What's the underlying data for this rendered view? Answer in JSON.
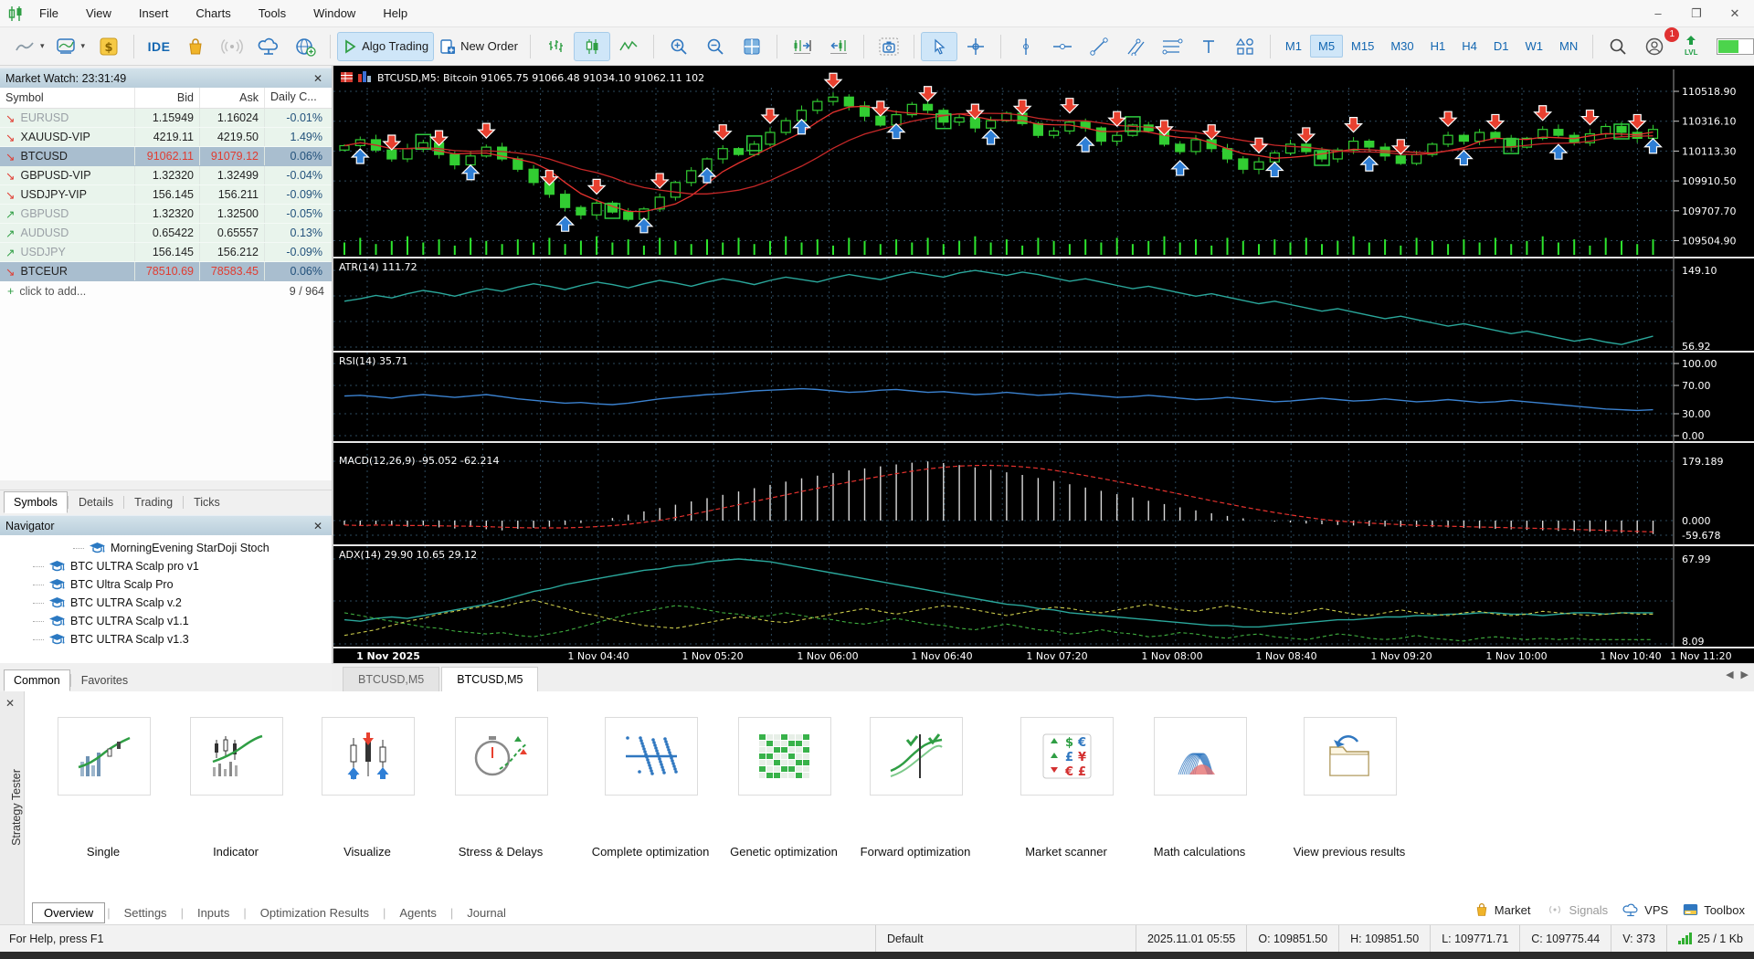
{
  "glyphs": {
    "close": "✕",
    "caret": "▾",
    "minimize": "–",
    "maximize": "❐",
    "window_close": "✕",
    "left": "◀",
    "right": "▶",
    "plus": "+",
    "down_arrow": "↘",
    "up_arrow": "↗"
  },
  "menu": {
    "items": [
      "File",
      "View",
      "Insert",
      "Charts",
      "Tools",
      "Window",
      "Help"
    ]
  },
  "toolbar": {
    "algo_trading": "Algo Trading",
    "new_order": "New Order",
    "ide_label": "IDE",
    "lvl_label": "LVL",
    "timeframes": [
      "M1",
      "M5",
      "M15",
      "M30",
      "H1",
      "H4",
      "D1",
      "W1",
      "MN"
    ],
    "active_timeframe": "M5",
    "notification_count": "1"
  },
  "market_watch": {
    "title": "Market Watch: 23:31:49",
    "columns": [
      "Symbol",
      "Bid",
      "Ask",
      "Daily C..."
    ],
    "rows": [
      {
        "symbol": "EURUSD",
        "bid": "1.15949",
        "ask": "1.16024",
        "daily": "-0.01%",
        "dir": "down",
        "dim": true,
        "selected": false,
        "hot": false
      },
      {
        "symbol": "XAUUSD-VIP",
        "bid": "4219.11",
        "ask": "4219.50",
        "daily": "1.49%",
        "dir": "down",
        "dim": false,
        "selected": false,
        "hot": false
      },
      {
        "symbol": "BTCUSD",
        "bid": "91062.11",
        "ask": "91079.12",
        "daily": "0.06%",
        "dir": "down",
        "dim": false,
        "selected": true,
        "hot": true
      },
      {
        "symbol": "GBPUSD-VIP",
        "bid": "1.32320",
        "ask": "1.32499",
        "daily": "-0.04%",
        "dir": "down",
        "dim": false,
        "selected": false,
        "hot": false
      },
      {
        "symbol": "USDJPY-VIP",
        "bid": "156.145",
        "ask": "156.211",
        "daily": "-0.09%",
        "dir": "down",
        "dim": false,
        "selected": false,
        "hot": false
      },
      {
        "symbol": "GBPUSD",
        "bid": "1.32320",
        "ask": "1.32500",
        "daily": "-0.05%",
        "dir": "up",
        "dim": true,
        "selected": false,
        "hot": false
      },
      {
        "symbol": "AUDUSD",
        "bid": "0.65422",
        "ask": "0.65557",
        "daily": "0.13%",
        "dir": "up",
        "dim": true,
        "selected": false,
        "hot": false
      },
      {
        "symbol": "USDJPY",
        "bid": "156.145",
        "ask": "156.212",
        "daily": "-0.09%",
        "dir": "up",
        "dim": true,
        "selected": false,
        "hot": false
      },
      {
        "symbol": "BTCEUR",
        "bid": "78510.69",
        "ask": "78583.45",
        "daily": "0.06%",
        "dir": "down",
        "dim": false,
        "selected": true,
        "hot": true
      }
    ],
    "add_row": "click to add...",
    "count": "9 / 964",
    "tabs": [
      "Symbols",
      "Details",
      "Trading",
      "Ticks"
    ],
    "active_tab": "Symbols"
  },
  "navigator": {
    "title": "Navigator",
    "items": [
      {
        "label": "MorningEvening StarDoji Stoch",
        "depth": 2
      },
      {
        "label": "BTC ULTRA Scalp pro v1",
        "depth": 1
      },
      {
        "label": "BTC Ultra Scalp Pro",
        "depth": 1
      },
      {
        "label": "BTC ULTRA Scalp v.2",
        "depth": 1
      },
      {
        "label": "BTC ULTRA Scalp v1.1",
        "depth": 1
      },
      {
        "label": "BTC ULTRA Scalp v1.3",
        "depth": 1
      }
    ],
    "tabs": [
      "Common",
      "Favorites"
    ],
    "active_tab": "Common"
  },
  "chart_tabs": {
    "tabs": [
      "BTCUSD,M5",
      "BTCUSD,M5"
    ],
    "active_index": 1
  },
  "tester": {
    "vertical_label": "Strategy Tester",
    "tiles": [
      {
        "label": "Single",
        "icon": "single-icon"
      },
      {
        "label": "Indicator",
        "icon": "indicator-icon"
      },
      {
        "label": "Visualize",
        "icon": "visualize-icon"
      },
      {
        "label": "Stress & Delays",
        "icon": "stress-delays-icon"
      },
      {
        "label": "Complete optimization",
        "icon": "complete-optimization-icon"
      },
      {
        "label": "Genetic optimization",
        "icon": "genetic-optimization-icon"
      },
      {
        "label": "Forward optimization",
        "icon": "forward-optimization-icon"
      },
      {
        "label": "Market scanner",
        "icon": "market-scanner-icon"
      },
      {
        "label": "Math calculations",
        "icon": "math-calculations-icon"
      },
      {
        "label": "View previous results",
        "icon": "view-previous-results-icon"
      }
    ],
    "tabs": [
      "Overview",
      "Settings",
      "Inputs",
      "Optimization Results",
      "Agents",
      "Journal"
    ],
    "active_tab": "Overview",
    "right_items": [
      {
        "label": "Market",
        "icon": "bag-icon",
        "dim": false
      },
      {
        "label": "Signals",
        "icon": "signal-icon",
        "dim": true
      },
      {
        "label": "VPS",
        "icon": "cloud-icon",
        "dim": false
      },
      {
        "label": "Toolbox",
        "icon": "toolbox-icon",
        "dim": false
      }
    ]
  },
  "status_bar": {
    "help": "For Help, press F1",
    "profile": "Default",
    "datetime": "2025.11.01 05:55",
    "o": "O: 109851.50",
    "h": "H: 109851.50",
    "l": "L: 109771.71",
    "c": "C: 109775.44",
    "v": "V: 373",
    "traffic": "25 / 1 Kb"
  },
  "chart_data": {
    "type": "candlestick+indicators",
    "title": "BTCUSD,M5: Bitcoin 91065.75 91066.48 91034.10 91062.11 102",
    "colors": {
      "bg": "#000000",
      "grid": "#2c4a5e",
      "bull": "#32cd32",
      "volume": "#2ee52e",
      "ma_fast": "#e5322e",
      "ma_slow": "#c62828",
      "atr": "#2aa79b",
      "rsi": "#3b82d0",
      "macd_hist": "#d8d8d8",
      "macd_signal": "#e5322e",
      "adx": "#2aa79b",
      "plus_di": "#3fae3f",
      "minus_di": "#c9c94a",
      "arrow_down": "#e8402f",
      "arrow_up": "#2f7fd6",
      "box": "#2ecc40",
      "text": "#ffffff"
    },
    "time_axis": {
      "labels": [
        "1 Nov 2025",
        "1 Nov 04:40",
        "1 Nov 05:20",
        "1 Nov 06:00",
        "1 Nov 06:40",
        "1 Nov 07:20",
        "1 Nov 08:00",
        "1 Nov 08:40",
        "1 Nov 09:20",
        "1 Nov 10:00",
        "1 Nov 10:40",
        "1 Nov 11:20"
      ],
      "centers": [
        60,
        290,
        415,
        541,
        666,
        792,
        918,
        1043,
        1169,
        1295,
        1420,
        1497
      ]
    },
    "main": {
      "yticks": [
        "110518.90",
        "110316.10",
        "110113.30",
        "109910.50",
        "109707.70",
        "109504.90"
      ],
      "ylim": [
        109409,
        110667
      ],
      "closes": [
        110150,
        110190,
        110120,
        110060,
        110130,
        110170,
        110090,
        110020,
        110080,
        110140,
        110060,
        109990,
        109900,
        109820,
        109730,
        109680,
        109760,
        109700,
        109650,
        109720,
        109800,
        109900,
        109980,
        110060,
        110130,
        110090,
        110160,
        110240,
        110320,
        110390,
        110450,
        110480,
        110420,
        110350,
        110290,
        110360,
        110430,
        110390,
        110310,
        110340,
        110270,
        110320,
        110370,
        110300,
        110220,
        110250,
        110310,
        110270,
        110180,
        110220,
        110290,
        110250,
        110160,
        110110,
        110190,
        110130,
        110060,
        109990,
        110040,
        110100,
        110160,
        110110,
        110060,
        110120,
        110180,
        110140,
        110080,
        110030,
        110090,
        110160,
        110220,
        110180,
        110240,
        110200,
        110140,
        110200,
        110260,
        110220,
        110170,
        110230,
        110280,
        110240,
        110200,
        110260
      ],
      "volume": [
        0.5,
        0.8,
        0.4,
        0.6,
        0.9,
        0.5,
        0.7,
        0.3,
        0.8,
        0.6,
        0.4,
        0.7,
        0.5,
        0.8,
        0.4,
        0.6,
        0.9,
        0.5,
        0.7,
        0.3,
        0.8,
        0.6,
        0.4,
        0.7,
        0.5,
        0.8,
        0.4,
        0.6,
        0.9,
        0.5,
        0.7,
        0.3,
        0.8,
        0.6,
        0.4,
        0.7,
        0.5,
        0.8,
        0.4,
        0.6,
        0.9,
        0.5,
        0.7,
        0.3,
        0.8,
        0.6,
        0.4,
        0.7,
        0.5,
        0.8,
        0.4,
        0.6,
        0.9,
        0.5,
        0.7,
        0.3,
        0.8,
        0.6,
        0.4,
        0.7,
        0.5,
        0.8,
        0.4,
        0.6,
        0.9,
        0.5,
        0.7,
        0.3,
        0.8,
        0.6,
        0.4,
        0.7,
        0.5,
        0.8,
        0.4,
        0.6,
        0.9,
        0.5,
        0.7,
        0.3,
        0.8,
        0.6,
        0.4,
        0.7
      ],
      "red_arrows": [
        3,
        6,
        9,
        13,
        16,
        20,
        24,
        27,
        31,
        34,
        37,
        40,
        43,
        46,
        49,
        52,
        55,
        58,
        61,
        64,
        67,
        70,
        73,
        76,
        79,
        82
      ],
      "blue_arrows": [
        1,
        8,
        14,
        19,
        23,
        29,
        35,
        41,
        47,
        53,
        59,
        65,
        71,
        77,
        83
      ],
      "green_boxes": [
        5,
        17,
        26,
        38,
        50,
        62,
        74,
        81
      ]
    },
    "atr": {
      "label": "ATR(14) 111.72",
      "yticks": [
        "149.10",
        "56.92"
      ],
      "values": [
        112,
        115,
        119,
        116,
        121,
        125,
        122,
        118,
        123,
        127,
        124,
        129,
        133,
        130,
        126,
        131,
        135,
        132,
        128,
        133,
        137,
        134,
        130,
        135,
        139,
        136,
        132,
        137,
        141,
        138,
        135,
        140,
        144,
        141,
        138,
        143,
        147,
        144,
        141,
        146,
        149,
        146,
        143,
        147,
        144,
        140,
        136,
        139,
        135,
        131,
        127,
        130,
        126,
        122,
        118,
        121,
        117,
        113,
        109,
        112,
        108,
        104,
        100,
        103,
        99,
        95,
        91,
        94,
        90,
        86,
        82,
        85,
        81,
        77,
        73,
        76,
        72,
        68,
        64,
        67,
        63,
        60,
        65,
        70
      ]
    },
    "rsi": {
      "label": "RSI(14) 35.71",
      "yticks": [
        "100.00",
        "70.00",
        "30.00",
        "0.00"
      ],
      "values": [
        55,
        56,
        54,
        52,
        55,
        57,
        55,
        53,
        55,
        57,
        54,
        51,
        49,
        47,
        45,
        46,
        44,
        43,
        45,
        48,
        51,
        53,
        55,
        57,
        58,
        60,
        62,
        63,
        64,
        65,
        64,
        62,
        60,
        61,
        63,
        64,
        62,
        60,
        61,
        59,
        57,
        58,
        60,
        58,
        56,
        57,
        59,
        57,
        55,
        53,
        54,
        56,
        54,
        52,
        50,
        51,
        53,
        51,
        49,
        47,
        48,
        50,
        52,
        50,
        48,
        49,
        51,
        49,
        47,
        48,
        50,
        48,
        46,
        47,
        49,
        47,
        45,
        43,
        41,
        39,
        37,
        36,
        35,
        36
      ]
    },
    "macd": {
      "label": "MACD(12,26,9) -95.052 -62.214",
      "yticks": [
        "179.189",
        "0.000",
        "-59.678"
      ],
      "hist": [
        -18,
        -22,
        -15,
        -20,
        -25,
        -20,
        -28,
        -32,
        -26,
        -35,
        -40,
        -34,
        -30,
        -25,
        -18,
        -10,
        -2,
        8,
        18,
        28,
        38,
        48,
        58,
        68,
        78,
        88,
        98,
        108,
        118,
        128,
        136,
        144,
        152,
        158,
        164,
        170,
        175,
        179,
        174,
        168,
        161,
        154,
        146,
        138,
        129,
        120,
        110,
        100,
        90,
        80,
        70,
        60,
        50,
        40,
        31,
        22,
        14,
        7,
        1,
        -4,
        -8,
        -12,
        -15,
        -18,
        -20,
        -22,
        -24,
        -25,
        -26,
        -27,
        -28,
        -30,
        -32,
        -34,
        -36,
        -38,
        -40,
        -42,
        -44,
        -46,
        -48,
        -50,
        -52,
        -55
      ]
    },
    "adx": {
      "label": "ADX(14) 29.90 10.65 29.12",
      "yticks": [
        "67.99",
        "8.09"
      ],
      "adx": [
        25,
        24,
        26,
        27,
        26,
        28,
        30,
        32,
        34,
        36,
        39,
        42,
        45,
        47,
        50,
        52,
        54,
        56,
        58,
        60,
        61,
        63,
        64,
        66,
        67,
        68,
        67,
        66,
        64,
        62,
        60,
        58,
        56,
        54,
        52,
        50,
        48,
        46,
        44,
        42,
        40,
        38,
        36,
        35,
        33,
        32,
        30,
        29,
        28,
        27,
        26,
        25,
        24,
        23,
        22,
        21,
        21,
        20,
        20,
        21,
        22,
        23,
        24,
        25,
        25,
        26,
        27,
        27,
        28,
        28,
        29,
        29,
        30,
        30,
        29,
        29,
        28,
        29,
        30,
        30,
        29,
        30,
        30,
        30
      ],
      "plus_di": [
        30,
        28,
        26,
        24,
        22,
        20,
        19,
        17,
        16,
        15,
        16,
        14,
        13,
        15,
        17,
        20,
        23,
        26,
        29,
        31,
        33,
        35,
        34,
        32,
        30,
        29,
        27,
        28,
        30,
        28,
        26,
        25,
        23,
        22,
        24,
        26,
        24,
        22,
        21,
        19,
        18,
        20,
        22,
        20,
        18,
        17,
        15,
        16,
        18,
        16,
        15,
        13,
        14,
        16,
        15,
        13,
        12,
        14,
        15,
        13,
        12,
        11,
        13,
        15,
        14,
        12,
        11,
        12,
        14,
        12,
        11,
        10,
        12,
        13,
        12,
        11,
        12,
        11,
        12,
        11,
        11,
        11,
        11,
        11
      ],
      "minus_di": [
        14,
        16,
        18,
        21,
        24,
        26,
        29,
        31,
        33,
        35,
        34,
        37,
        39,
        36,
        33,
        30,
        28,
        25,
        23,
        21,
        20,
        19,
        21,
        23,
        25,
        27,
        26,
        24,
        23,
        25,
        27,
        29,
        31,
        33,
        31,
        29,
        31,
        33,
        35,
        34,
        32,
        30,
        28,
        30,
        32,
        34,
        33,
        31,
        30,
        32,
        34,
        36,
        34,
        32,
        31,
        33,
        35,
        33,
        31,
        30,
        29,
        31,
        33,
        31,
        29,
        28,
        30,
        32,
        30,
        29,
        28,
        30,
        31,
        29,
        28,
        29,
        31,
        30,
        29,
        28,
        29,
        30,
        29,
        29
      ]
    }
  }
}
